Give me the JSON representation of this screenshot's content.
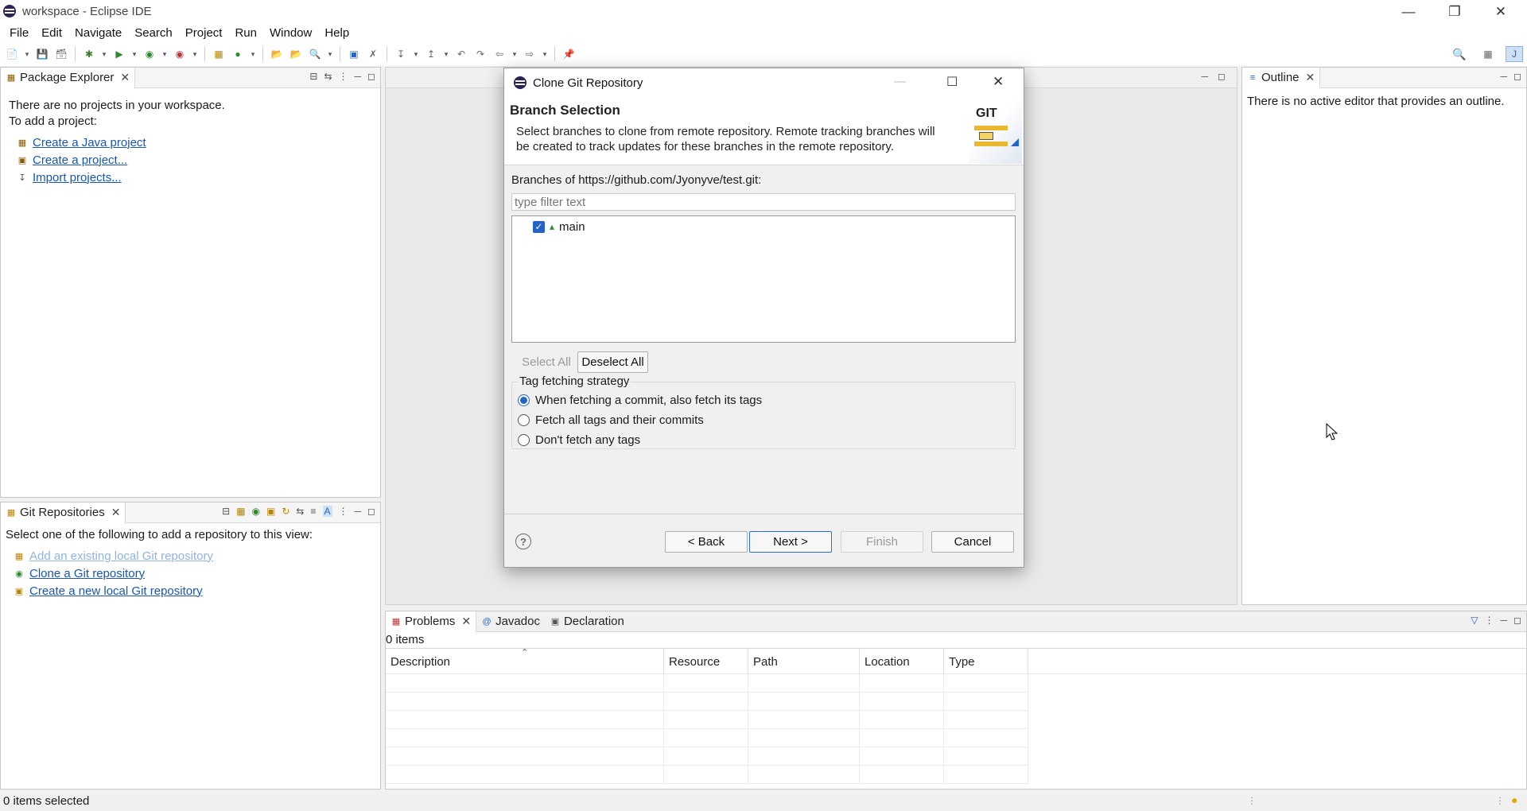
{
  "window": {
    "title": "workspace - Eclipse IDE"
  },
  "menu": [
    "File",
    "Edit",
    "Navigate",
    "Search",
    "Project",
    "Run",
    "Window",
    "Help"
  ],
  "package_explorer": {
    "tab": "Package Explorer",
    "line1": "There are no projects in your workspace.",
    "line2": "To add a project:",
    "links": [
      "Create a Java project",
      "Create a project...",
      "Import projects..."
    ]
  },
  "git_repos": {
    "tab": "Git Repositories",
    "intro": "Select one of the following to add a repository to this view:",
    "links": [
      "Add an existing local Git repository",
      "Clone a Git repository",
      "Create a new local Git repository"
    ]
  },
  "outline": {
    "tab": "Outline",
    "message": "There is no active editor that provides an outline."
  },
  "problems": {
    "tabs": [
      "Problems",
      "Javadoc",
      "Declaration"
    ],
    "count": "0 items",
    "columns": [
      "Description",
      "Resource",
      "Path",
      "Location",
      "Type"
    ]
  },
  "status": {
    "text": "0 items selected"
  },
  "dialog": {
    "title": "Clone Git Repository",
    "heading": "Branch Selection",
    "desc1": "Select branches to clone from remote repository. Remote tracking branches will",
    "desc2": "be created to track updates for these branches in the remote repository.",
    "git_logo": "GIT",
    "branches_label": "Branches of https://github.com/Jyonyve/test.git:",
    "filter_placeholder": "type filter text",
    "branches": [
      {
        "name": "main",
        "checked": true
      }
    ],
    "select_all": "Select All",
    "deselect_all": "Deselect All",
    "tag_group": "Tag fetching strategy",
    "tag_options": [
      {
        "label": "When fetching a commit, also fetch its tags",
        "selected": true
      },
      {
        "label": "Fetch all tags and their commits",
        "selected": false
      },
      {
        "label": "Don't fetch any tags",
        "selected": false
      }
    ],
    "back": "< Back",
    "next": "Next >",
    "finish": "Finish",
    "cancel": "Cancel"
  },
  "colors": {
    "link": "#1a55b0",
    "accent": "#2463c8"
  }
}
